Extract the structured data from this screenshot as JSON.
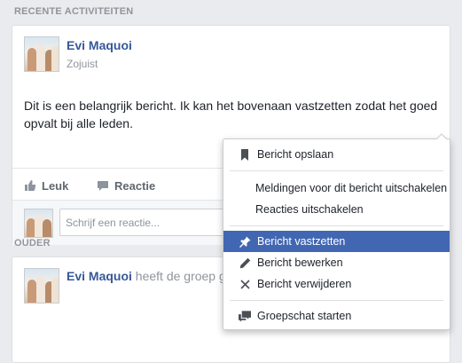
{
  "sections": {
    "recent_label": "RECENTE ACTIVITEITEN",
    "older_label": "OUDER"
  },
  "post1": {
    "author": "Evi Maquoi",
    "timestamp": "Zojuist",
    "text": "Dit is een belangrijk bericht. Ik kan het bovenaan vastzetten zodat het goed opvalt bij alle leden.",
    "like_label": "Leuk",
    "comment_label": "Reactie",
    "comment_placeholder": "Schrijf een reactie..."
  },
  "post2": {
    "author": "Evi Maquoi",
    "action_text": "heeft de groep g"
  },
  "menu": {
    "items": [
      {
        "label": "Bericht opslaan",
        "icon": "bookmark-icon"
      },
      {
        "label": "Meldingen voor dit bericht uitschakelen"
      },
      {
        "label": "Reacties uitschakelen"
      },
      {
        "label": "Bericht vastzetten",
        "icon": "pin-icon",
        "active": true
      },
      {
        "label": "Bericht bewerken",
        "icon": "pencil-icon"
      },
      {
        "label": "Bericht verwijderen",
        "icon": "close-icon"
      },
      {
        "label": "Groepschat starten",
        "icon": "chat-icon"
      }
    ]
  },
  "colors": {
    "accent": "#4267b2",
    "author": "#365899",
    "page_bg": "#e9ebee"
  }
}
